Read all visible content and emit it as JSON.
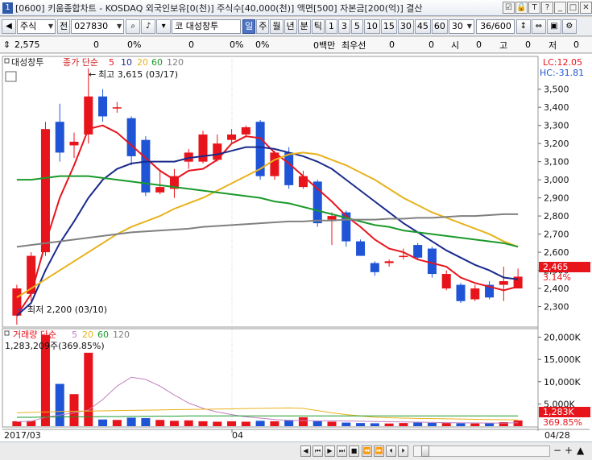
{
  "window": {
    "screen_no": "1",
    "title": "[0600] 키움종합차트 - KOSDAQ 외국인보유[0(천)] 주식수[40,000(천)] 액면[500] 자본금[200(억)] 결산",
    "buttons": [
      "☑",
      "🔒",
      "T",
      "?",
      "_",
      "□",
      "✕"
    ]
  },
  "toolbar": {
    "market": "주식",
    "prev_label": "전",
    "code": "027830",
    "stock_name": "코 대성창투",
    "periods": [
      "일",
      "주",
      "월",
      "년",
      "분",
      "틱"
    ],
    "active_period": "일",
    "intervals": [
      "1",
      "3",
      "5",
      "10",
      "15",
      "30",
      "45",
      "60"
    ],
    "interval_value": "30",
    "count": "36/600"
  },
  "quote": {
    "price": "2,575",
    "change": "0",
    "change_pct": "0%",
    "volume_ratio": "0",
    "rate": "0%",
    "amount": "0백만",
    "best_bid_label": "최우선",
    "bid": "0",
    "ask": "0",
    "open_label": "시",
    "open": "0",
    "high_label": "고",
    "high": "0",
    "low_label": "저",
    "low": "0"
  },
  "price_panel": {
    "name": "대성창투",
    "legend_label": "종가 단순",
    "ma_periods": [
      "5",
      "10",
      "20",
      "60",
      "120"
    ],
    "lc": "LC:12.05",
    "hc": "HC:-31.81",
    "max_annotation": "최고 3,615 (03/17)",
    "min_annotation": "최저 2,200 (03/10)",
    "current_price_tag": "2,465",
    "current_pct_tag": "3.14%"
  },
  "volume_panel": {
    "legend_label": "거래량 단순",
    "ma_periods": [
      "5",
      "20",
      "60",
      "120"
    ],
    "last_volume": "1,283,209주(369.85%)",
    "current_tag": "1,283K",
    "current_pct": "369.85%"
  },
  "x_axis": {
    "labels": [
      "2017/03",
      "04"
    ],
    "right_label": "04/28"
  },
  "colors": {
    "up": "#e8141c",
    "down": "#1f54d6",
    "ma5": "#e8141c",
    "ma10": "#1a2a8c",
    "ma20": "#e8b21c",
    "ma60": "#1a9a2a",
    "ma120": "#808080"
  },
  "chart_data": [
    {
      "type": "candlestick",
      "title": "대성창투",
      "y_ticks": [
        2300,
        2400,
        2500,
        2600,
        2700,
        2800,
        2900,
        3000,
        3100,
        3200,
        3300,
        3400,
        3500
      ],
      "ylim": [
        2200,
        3650
      ],
      "candles": [
        {
          "o": 2250,
          "h": 2420,
          "l": 2200,
          "c": 2400
        },
        {
          "o": 2370,
          "h": 2600,
          "l": 2320,
          "c": 2580
        },
        {
          "o": 2600,
          "h": 3320,
          "l": 2580,
          "c": 3280
        },
        {
          "o": 3320,
          "h": 3420,
          "l": 3100,
          "c": 3150
        },
        {
          "o": 3190,
          "h": 3260,
          "l": 3120,
          "c": 3210
        },
        {
          "o": 3250,
          "h": 3615,
          "l": 3200,
          "c": 3460
        },
        {
          "o": 3460,
          "h": 3500,
          "l": 3320,
          "c": 3350
        },
        {
          "o": 3400,
          "h": 3430,
          "l": 3370,
          "c": 3400
        },
        {
          "o": 3340,
          "h": 3350,
          "l": 3080,
          "c": 3130
        },
        {
          "o": 3220,
          "h": 3240,
          "l": 2910,
          "c": 2930
        },
        {
          "o": 2930,
          "h": 3050,
          "l": 2920,
          "c": 2960
        },
        {
          "o": 2950,
          "h": 3060,
          "l": 2900,
          "c": 3020
        },
        {
          "o": 3100,
          "h": 3170,
          "l": 3060,
          "c": 3150
        },
        {
          "o": 3100,
          "h": 3270,
          "l": 3090,
          "c": 3250
        },
        {
          "o": 3110,
          "h": 3250,
          "l": 3100,
          "c": 3200
        },
        {
          "o": 3220,
          "h": 3280,
          "l": 3200,
          "c": 3250
        },
        {
          "o": 3250,
          "h": 3300,
          "l": 3240,
          "c": 3290
        },
        {
          "o": 3320,
          "h": 3330,
          "l": 3000,
          "c": 3020
        },
        {
          "o": 3020,
          "h": 3160,
          "l": 3000,
          "c": 3150
        },
        {
          "o": 3150,
          "h": 3180,
          "l": 2950,
          "c": 2970
        },
        {
          "o": 2960,
          "h": 3050,
          "l": 2950,
          "c": 3020
        },
        {
          "o": 2990,
          "h": 3000,
          "l": 2740,
          "c": 2760
        },
        {
          "o": 2780,
          "h": 2820,
          "l": 2640,
          "c": 2800
        },
        {
          "o": 2820,
          "h": 2830,
          "l": 2630,
          "c": 2660
        },
        {
          "o": 2660,
          "h": 2670,
          "l": 2580,
          "c": 2580
        },
        {
          "o": 2540,
          "h": 2550,
          "l": 2470,
          "c": 2490
        },
        {
          "o": 2540,
          "h": 2560,
          "l": 2520,
          "c": 2550
        },
        {
          "o": 2580,
          "h": 2620,
          "l": 2560,
          "c": 2580
        },
        {
          "o": 2640,
          "h": 2650,
          "l": 2560,
          "c": 2570
        },
        {
          "o": 2620,
          "h": 2630,
          "l": 2460,
          "c": 2480
        },
        {
          "o": 2400,
          "h": 2500,
          "l": 2390,
          "c": 2480
        },
        {
          "o": 2420,
          "h": 2430,
          "l": 2320,
          "c": 2330
        },
        {
          "o": 2340,
          "h": 2420,
          "l": 2330,
          "c": 2400
        },
        {
          "o": 2420,
          "h": 2440,
          "l": 2340,
          "c": 2350
        },
        {
          "o": 2420,
          "h": 2520,
          "l": 2330,
          "c": 2440
        },
        {
          "o": 2400,
          "h": 2510,
          "l": 2400,
          "c": 2465
        }
      ],
      "ma_series": [
        {
          "name": "5",
          "values": [
            2250,
            2370,
            2650,
            2900,
            3080,
            3280,
            3300,
            3260,
            3190,
            3120,
            3050,
            3000,
            3050,
            3060,
            3110,
            3200,
            3240,
            3230,
            3150,
            3090,
            3020,
            2950,
            2880,
            2800,
            2740,
            2670,
            2620,
            2600,
            2560,
            2540,
            2520,
            2460,
            2430,
            2410,
            2390,
            2410
          ]
        },
        {
          "name": "10",
          "values": [
            2250,
            2320,
            2500,
            2650,
            2770,
            2900,
            3000,
            3060,
            3090,
            3100,
            3100,
            3100,
            3120,
            3130,
            3140,
            3160,
            3180,
            3180,
            3170,
            3150,
            3130,
            3100,
            3060,
            3000,
            2940,
            2880,
            2820,
            2760,
            2710,
            2660,
            2610,
            2570,
            2530,
            2500,
            2460,
            2450
          ]
        },
        {
          "name": "20",
          "values": [
            2350,
            2400,
            2450,
            2500,
            2550,
            2600,
            2650,
            2700,
            2740,
            2770,
            2800,
            2840,
            2870,
            2900,
            2940,
            2980,
            3020,
            3060,
            3110,
            3140,
            3150,
            3140,
            3110,
            3080,
            3040,
            3000,
            2950,
            2900,
            2860,
            2820,
            2790,
            2760,
            2730,
            2700,
            2660,
            2630
          ]
        },
        {
          "name": "60",
          "values": [
            3000,
            3000,
            3010,
            3020,
            3020,
            3020,
            3010,
            3000,
            2990,
            2980,
            2970,
            2960,
            2950,
            2940,
            2930,
            2920,
            2910,
            2900,
            2880,
            2870,
            2850,
            2830,
            2810,
            2790,
            2770,
            2750,
            2740,
            2720,
            2710,
            2700,
            2690,
            2680,
            2670,
            2660,
            2650,
            2630
          ]
        },
        {
          "name": "120",
          "values": [
            2630,
            2640,
            2650,
            2660,
            2670,
            2680,
            2690,
            2700,
            2710,
            2715,
            2720,
            2725,
            2730,
            2740,
            2745,
            2750,
            2755,
            2760,
            2765,
            2770,
            2770,
            2775,
            2775,
            2780,
            2780,
            2780,
            2785,
            2785,
            2790,
            2790,
            2795,
            2800,
            2800,
            2805,
            2810,
            2810
          ]
        }
      ]
    },
    {
      "type": "bar",
      "title": "거래량",
      "y_ticks": [
        "5,000K",
        "10,000K",
        "15,000K",
        "20,000K"
      ],
      "ylim": [
        0,
        21000000
      ],
      "volumes": [
        1100000,
        1200000,
        20500000,
        9500000,
        7200000,
        16500000,
        1500000,
        1400000,
        1900000,
        1800000,
        1400000,
        1200000,
        1300000,
        1100000,
        1000000,
        1100000,
        1000000,
        1200000,
        1100000,
        1400000,
        2000000,
        1100000,
        1000000,
        800000,
        700000,
        650000,
        600000,
        700000,
        800000,
        750000,
        700000,
        650000,
        600000,
        700000,
        900000,
        1283209
      ],
      "ma5": [
        1000000,
        1100000,
        2000000,
        2500000,
        3000000,
        3600000,
        6000000,
        9000000,
        11000000,
        10500000,
        9000000,
        7000000,
        5200000,
        4000000,
        3200000,
        2600000,
        2100000,
        1800000,
        1500000,
        1300000,
        1250000,
        1200000,
        1200000,
        1150000,
        1100000,
        1050000,
        1000000,
        950000,
        900000,
        850000,
        800000,
        750000,
        720000,
        700000,
        700000,
        780000
      ],
      "ma20": [
        3000000,
        3100000,
        3200000,
        3300000,
        3350000,
        3400000,
        3450000,
        3500000,
        3550000,
        3600000,
        3650000,
        3700000,
        3750000,
        3800000,
        3850000,
        3900000,
        3950000,
        4000000,
        4050000,
        4100000,
        4000000,
        3500000,
        3000000,
        2600000,
        2300000,
        2000000,
        1900000,
        1800000,
        1750000,
        1700000,
        1650000,
        1600000,
        1550000,
        1500000,
        1450000,
        1400000
      ],
      "ma60": [
        2000000,
        2000000,
        2050000,
        2050000,
        2100000,
        2100000,
        2150000,
        2150000,
        2200000,
        2200000,
        2250000,
        2250000,
        2300000,
        2300000,
        2300000,
        2300000,
        2300000,
        2300000,
        2300000,
        2300000,
        2300000,
        2300000,
        2300000,
        2300000,
        2300000,
        2300000,
        2300000,
        2300000,
        2300000,
        2300000,
        2300000,
        2300000,
        2300000,
        2300000,
        2300000,
        2300000
      ]
    }
  ]
}
